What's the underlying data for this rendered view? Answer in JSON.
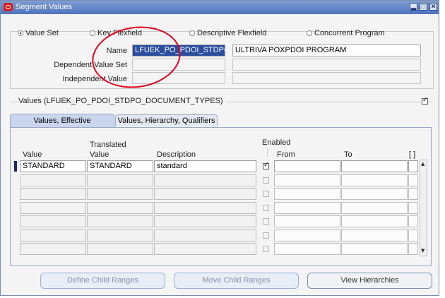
{
  "window": {
    "title": "Segment Values",
    "controls": {
      "minimize": "▂",
      "maximize": "□",
      "close": "✕"
    }
  },
  "query": {
    "radio_options": [
      {
        "label": "Value Set",
        "selected": true
      },
      {
        "label": "Key Flexfield",
        "selected": false
      },
      {
        "label": "Descriptive Flexfield",
        "selected": false
      },
      {
        "label": "Concurrent Program",
        "selected": false
      }
    ],
    "name_label": "Name",
    "name_value": "LFUEK_PO_PDOI_STDPO",
    "name_description": "ULTRIVA POXPDOI PROGRAM",
    "dependent_label": "Dependent Value Set",
    "independent_label": "Independent Value"
  },
  "values_section": {
    "title": "Values (LFUEK_PO_PDOI_STDPO_DOCUMENT_TYPES)",
    "checkbox_checked": true
  },
  "tabs": [
    {
      "label": "Values, Effective",
      "active": true
    },
    {
      "label": "Values, Hierarchy, Qualifiers",
      "active": false
    }
  ],
  "table": {
    "headers": {
      "value": "Value",
      "translated_top": "Translated",
      "translated_bottom": "Value",
      "description": "Description",
      "enabled": "Enabled",
      "from": "From",
      "to": "To",
      "flex": "[ ]"
    },
    "rows": [
      {
        "value": "STANDARD",
        "translated": "STANDARD",
        "description": "standard",
        "enabled": true
      },
      {
        "value": "",
        "translated": "",
        "description": "",
        "enabled": false
      },
      {
        "value": "",
        "translated": "",
        "description": "",
        "enabled": false
      },
      {
        "value": "",
        "translated": "",
        "description": "",
        "enabled": false
      },
      {
        "value": "",
        "translated": "",
        "description": "",
        "enabled": false
      },
      {
        "value": "",
        "translated": "",
        "description": "",
        "enabled": false
      },
      {
        "value": "",
        "translated": "",
        "description": "",
        "enabled": false
      }
    ]
  },
  "buttons": {
    "define_child_ranges": "Define Child Ranges",
    "move_child_ranges": "Move Child Ranges",
    "view_hierarchies": "View Hierarchies"
  },
  "colors": {
    "title_bar": "#4d73bd",
    "selection": "#2a4d9d",
    "annotation_circle": "#e3001b"
  }
}
